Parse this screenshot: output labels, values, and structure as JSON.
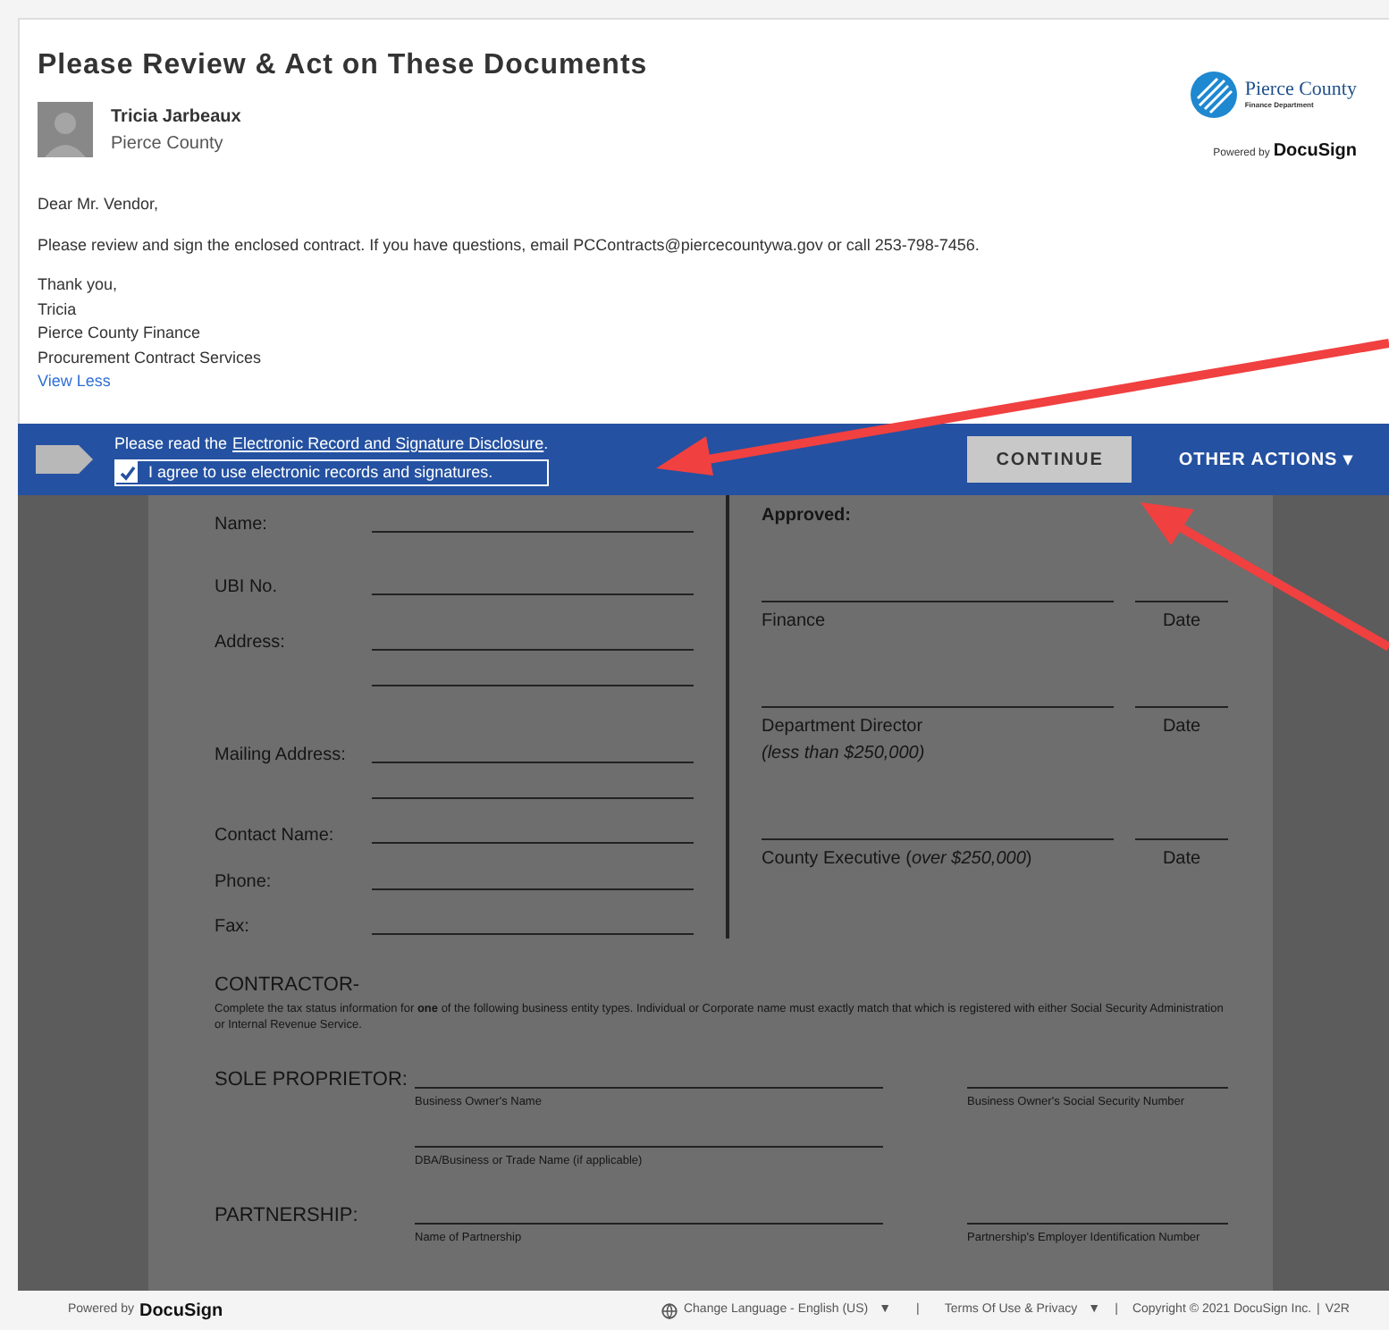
{
  "header": {
    "title": "Please Review & Act on These Documents",
    "sender": {
      "name": "Tricia Jarbeaux",
      "org": "Pierce County"
    },
    "logo": {
      "name": "Pierce County",
      "subtitle": "Finance Department"
    },
    "powered": {
      "label": "Powered by",
      "brand": "DocuSign"
    }
  },
  "message": {
    "lines": [
      "Dear Mr. Vendor,",
      "Please review and sign the enclosed contract.  If you have questions, email PCContracts@piercecountywa.gov or call 253-798-7456."
    ],
    "signature": [
      "Thank you,",
      "Tricia",
      "Pierce County Finance",
      "Procurement Contract Services"
    ],
    "toggle": "View Less"
  },
  "action_bar": {
    "prompt": "Please read the",
    "link": "Electronic Record and Signature Disclosure",
    "period": ".",
    "agree": {
      "label": "I agree to use electronic records and signatures.",
      "checked": true
    },
    "continue": "CONTINUE",
    "other_actions": "OTHER ACTIONS ▾"
  },
  "document": {
    "fields": [
      {
        "kind": "field",
        "label": "Name:"
      },
      {
        "kind": "field",
        "label": "UBI No."
      },
      {
        "kind": "field",
        "label": "Address:"
      },
      {
        "kind": "continuation"
      },
      {
        "kind": "field",
        "label": "Mailing Address:"
      },
      {
        "kind": "continuation"
      },
      {
        "kind": "field",
        "label": "Contact Name:"
      },
      {
        "kind": "field",
        "label": "Phone:"
      },
      {
        "kind": "field",
        "label": "Fax:"
      }
    ],
    "approved": "Approved:",
    "signatures": [
      {
        "label": "Finance",
        "date": "Date"
      },
      {
        "label": "Department Director",
        "note": "(less than $250,000)",
        "date": "Date"
      },
      {
        "label": "County Executive (*over $250,000*)",
        "date": "Date"
      }
    ],
    "contractor": {
      "heading": "CONTRACTOR-",
      "note": "Complete the tax status information for **one** of the following business entity types. Individual or Corporate name must exactly match that which is registered with either Social Security Administration or Internal Revenue Service.",
      "entities": [
        {
          "label": "SOLE PROPRIETOR:",
          "lines": [
            {
              "caption": "Business Owner's Name",
              "side": "Business Owner's Social Security Number"
            },
            {
              "caption": "DBA/Business or Trade Name (if applicable)"
            }
          ]
        },
        {
          "label": "PARTNERSHIP:",
          "lines": [
            {
              "caption": "Name of Partnership",
              "side": "Partnership's Employer Identification Number"
            }
          ]
        }
      ]
    }
  },
  "footer": {
    "powered": "Powered by",
    "brand": "DocuSign",
    "language": "Change Language - English (US)",
    "terms": "Terms Of Use & Privacy",
    "caret": "▼",
    "separator": "|",
    "copyright": "Copyright © 2021 DocuSign Inc.",
    "version": "V2R"
  }
}
